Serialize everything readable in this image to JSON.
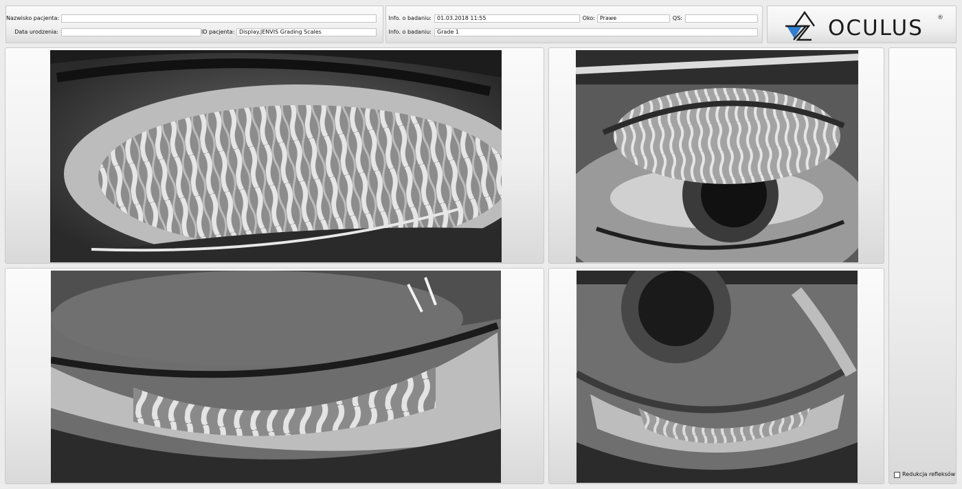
{
  "header": {
    "patient": {
      "surname_label": "Nazwisko pacjenta:",
      "surname_value": "",
      "dob_label": "Data urodzenia:",
      "dob_value": "",
      "id_label": "ID pacjenta:",
      "id_value": "Display.JENVIS Grading Scales"
    },
    "exam": {
      "info_label_1": "Info. o badaniu:",
      "info_value_1": "01.03.2018 11:55",
      "eye_label": "Oko:",
      "eye_value": "Prawe",
      "qs_label": "QS:",
      "qs_value": "",
      "info_label_2": "Info. o badaniu:",
      "info_value_2": "Grade 1"
    }
  },
  "logo": {
    "brand": "OCULUS",
    "registered_mark": "®",
    "icon": "oculus-eye-logo-icon",
    "accent_color": "#2e7fd1"
  },
  "images": [
    {
      "icon": "everted-upper-eyelid-meibography-image"
    },
    {
      "icon": "upper-eyelid-everted-eye-image"
    },
    {
      "icon": "lower-eyelid-meibography-image"
    },
    {
      "icon": "lower-eyelid-everted-eye-image"
    }
  ],
  "sidebar": {
    "reflex_reduction_label": "Redukcja refleksów",
    "reflex_reduction_checked": false
  }
}
